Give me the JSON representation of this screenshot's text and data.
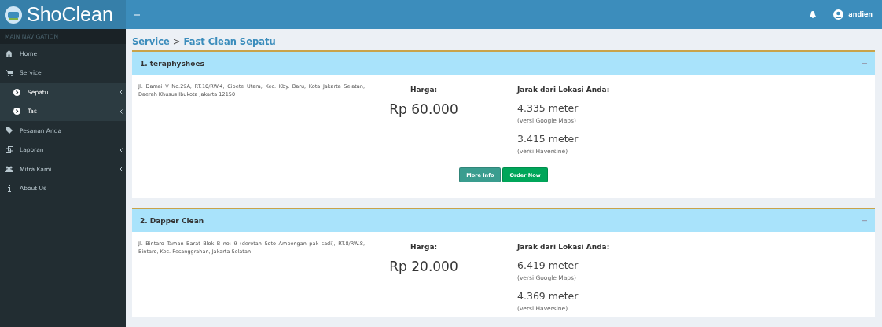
{
  "header": {
    "logo": "ShoClean",
    "user": "andien"
  },
  "sidebar": {
    "heading": "MAIN NAVIGATION",
    "items": [
      {
        "label": "Home",
        "has_submenu": false
      },
      {
        "label": "Service",
        "has_submenu": false,
        "children": [
          {
            "label": "Sepatu",
            "has_submenu": true
          },
          {
            "label": "Tas",
            "has_submenu": true
          }
        ]
      },
      {
        "label": "Pesanan Anda",
        "has_submenu": false
      },
      {
        "label": "Laporan",
        "has_submenu": true
      },
      {
        "label": "Mitra Kami",
        "has_submenu": true
      },
      {
        "label": "About Us",
        "has_submenu": false
      }
    ]
  },
  "breadcrumb": {
    "parent": "Service",
    "separator": ">",
    "current": "Fast Clean Sepatu"
  },
  "shops": [
    {
      "title": "1. teraphyshoes",
      "address": "Jl. Damai V No.29A, RT.10/RW.4, Cipete Utara, Kec. Kby. Baru, Kota Jakarta Selatan, Daerah Khusus Ibukota Jakarta 12150",
      "price_label": "Harga:",
      "price": "Rp 60.000",
      "distance_label": "Jarak dari Lokasi Anda:",
      "distances": [
        {
          "value": "4.335 meter",
          "note": "(versi Google Maps)"
        },
        {
          "value": "3.415 meter",
          "note": "(versi Haversine)"
        }
      ],
      "buttons": [
        "More Info",
        "Order Now"
      ]
    },
    {
      "title": "2. Dapper Clean",
      "address": "Jl. Bintaro Taman Barat Blok B no: 9 (deretan Soto Ambengan pak sadi), RT.8/RW.8, Bintaro, Kec. Pesanggrahan, Jakarta Selatan",
      "price_label": "Harga:",
      "price": "Rp 20.000",
      "distance_label": "Jarak dari Lokasi Anda:",
      "distances": [
        {
          "value": "6.419 meter",
          "note": "(versi Google Maps)"
        },
        {
          "value": "4.369 meter",
          "note": "(versi Haversine)"
        }
      ]
    }
  ]
}
